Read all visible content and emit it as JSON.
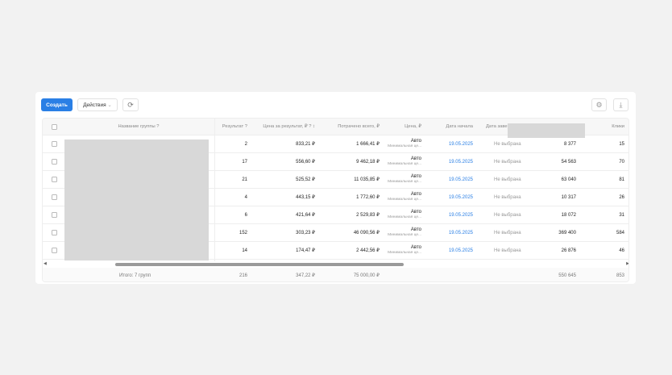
{
  "toolbar": {
    "create": "Создать",
    "actions": "Действия",
    "chevron": "⌄",
    "refresh": "⟳",
    "settings": "⚙",
    "download": "⤓"
  },
  "header": {
    "name": "Название группы",
    "result": "Результат",
    "price_per_result": "Цена за результат, ₽",
    "spent": "Потрачено всего, ₽",
    "price": "Цена, ₽",
    "start": "Дата начала",
    "end": "Дата заве",
    "clicks": "Клики",
    "info": "?",
    "sort": "↕"
  },
  "rows": [
    {
      "result": "2",
      "ppr": "833,21 ₽",
      "spent": "1 666,41 ₽",
      "price": "Авто",
      "price_sub": "Минимальная це...",
      "start": "19.05.2025",
      "end": "Не выбрана",
      "col": "8 377",
      "clicks": "15"
    },
    {
      "result": "17",
      "ppr": "556,60 ₽",
      "spent": "9 462,18 ₽",
      "price": "Авто",
      "price_sub": "Минимальная це...",
      "start": "19.05.2025",
      "end": "Не выбрана",
      "col": "54 563",
      "clicks": "70"
    },
    {
      "result": "21",
      "ppr": "525,52 ₽",
      "spent": "11 035,85 ₽",
      "price": "Авто",
      "price_sub": "Минимальная це...",
      "start": "19.05.2025",
      "end": "Не выбрана",
      "col": "63 040",
      "clicks": "81"
    },
    {
      "result": "4",
      "ppr": "443,15 ₽",
      "spent": "1 772,60 ₽",
      "price": "Авто",
      "price_sub": "Минимальная це...",
      "start": "19.05.2025",
      "end": "Не выбрана",
      "col": "10 317",
      "clicks": "26"
    },
    {
      "result": "6",
      "ppr": "421,64 ₽",
      "spent": "2 529,83 ₽",
      "price": "Авто",
      "price_sub": "Минимальная це...",
      "start": "19.05.2025",
      "end": "Не выбрана",
      "col": "18 072",
      "clicks": "31"
    },
    {
      "result": "152",
      "ppr": "303,23 ₽",
      "spent": "46 090,56 ₽",
      "price": "Авто",
      "price_sub": "Минимальная це...",
      "start": "19.05.2025",
      "end": "Не выбрана",
      "col": "369 400",
      "clicks": "584"
    },
    {
      "result": "14",
      "ppr": "174,47 ₽",
      "spent": "2 442,56 ₽",
      "price": "Авто",
      "price_sub": "Минимальная це...",
      "start": "19.05.2025",
      "end": "Не выбрана",
      "col": "26 876",
      "clicks": "46"
    }
  ],
  "totals": {
    "label": "Итого: 7 групп",
    "result": "216",
    "ppr": "347,22 ₽",
    "spent": "75 000,00 ₽",
    "col": "550 645",
    "clicks": "853"
  }
}
